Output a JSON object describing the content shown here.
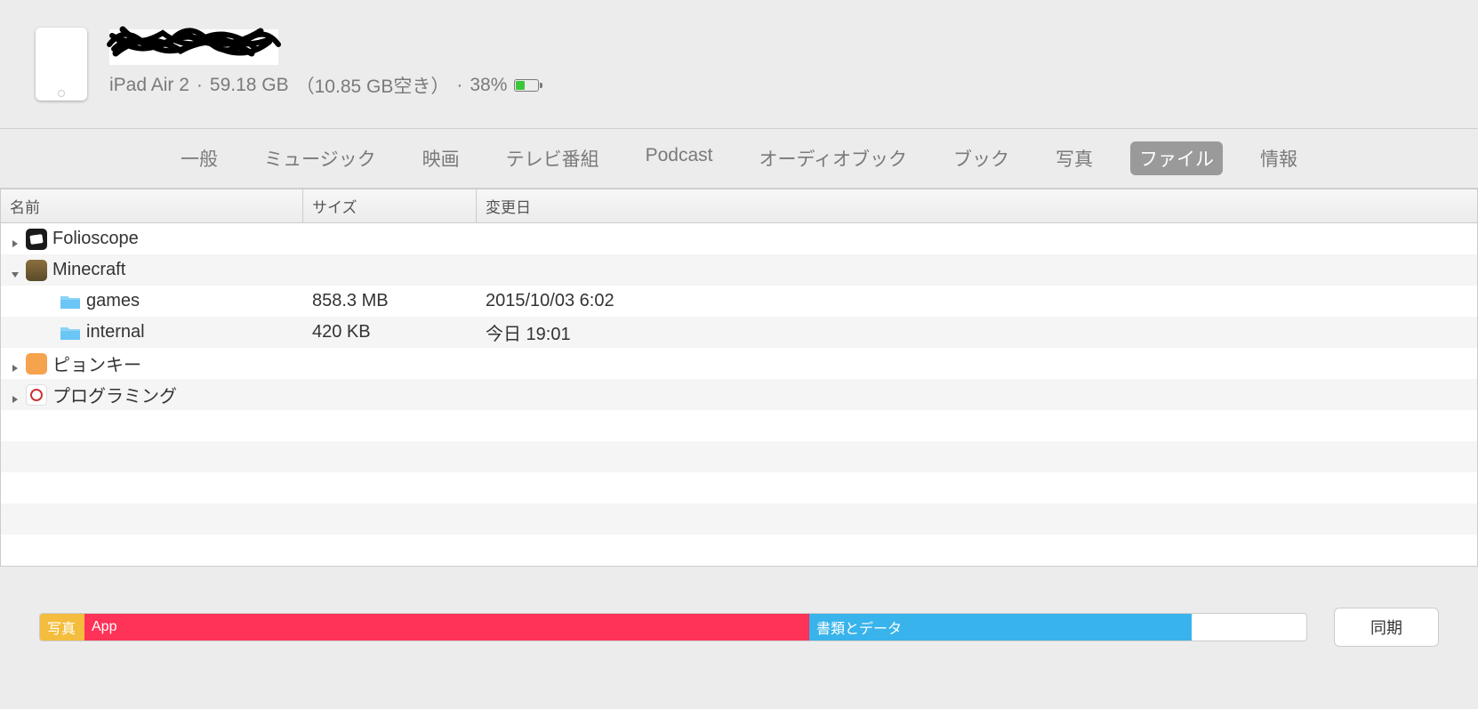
{
  "device": {
    "model": "iPad Air 2",
    "storage_total": "59.18 GB",
    "storage_free_label": "（10.85 GB空き）",
    "battery_percent": "38%"
  },
  "tabs": [
    {
      "label": "一般",
      "active": false
    },
    {
      "label": "ミュージック",
      "active": false
    },
    {
      "label": "映画",
      "active": false
    },
    {
      "label": "テレビ番組",
      "active": false
    },
    {
      "label": "Podcast",
      "active": false
    },
    {
      "label": "オーディオブック",
      "active": false
    },
    {
      "label": "ブック",
      "active": false
    },
    {
      "label": "写真",
      "active": false
    },
    {
      "label": "ファイル",
      "active": true
    },
    {
      "label": "情報",
      "active": false
    }
  ],
  "table": {
    "columns": {
      "name": "名前",
      "size": "サイズ",
      "date": "変更日"
    },
    "rows": [
      {
        "type": "app",
        "name": "Folioscope",
        "expanded": false,
        "icon": "folioscope"
      },
      {
        "type": "app",
        "name": "Minecraft",
        "expanded": true,
        "icon": "minecraft"
      },
      {
        "type": "folder",
        "name": "games",
        "size": "858.3 MB",
        "date": "2015/10/03 6:02"
      },
      {
        "type": "folder",
        "name": "internal",
        "size": "420 KB",
        "date": "今日 19:01"
      },
      {
        "type": "app",
        "name": "ピョンキー",
        "expanded": false,
        "icon": "pyonkee"
      },
      {
        "type": "app",
        "name": "プログラミング",
        "expanded": false,
        "icon": "programming"
      }
    ]
  },
  "storage_segments": {
    "photos": "写真",
    "app": "App",
    "docs": "書類とデータ"
  },
  "sync_button": "同期"
}
